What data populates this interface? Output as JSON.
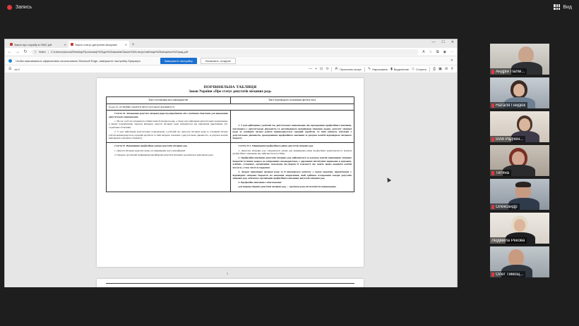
{
  "meeting": {
    "record_label": "Запись",
    "view_label": "Вид"
  },
  "browser": {
    "tabs": [
      {
        "title": "Закон про службу в ОМС.pdf",
        "active": false
      },
      {
        "title": "Закон статус депутатів місцевих",
        "active": true
      }
    ],
    "url_host": "Файл",
    "url": "C:/Users/ryboval/Desktop/Пропозиції%20до%20законів/Закон%20статус/таблиця%20місцевих%20рад.pdf",
    "notify_text": "Чтобы максимально эффективно использовать Microsoft Edge, завершите настройку браузера.",
    "notify_primary": "Завершить настройку",
    "notify_secondary": "Возможно, позднее",
    "page_indicator": "из 2",
    "toolbar": {
      "read_aloud": "Прочитать вслух",
      "draw": "Нарисовать",
      "highlight": "Выделение",
      "erase": "Стереть"
    }
  },
  "document": {
    "title": "ПОРІВНЯЛЬНА ТАБЛИЦЯ",
    "subtitle": "Закон України «Про статус депутатів місцевих рад»",
    "col_left": "Зміст положення акта законодавства",
    "col_right": "Зміст відповідного положення проекту акта",
    "section": "Розділ IV. ОСНОВНІ ГАРАНТІЇ ДЕПУТАТСЬКОЇ ДІЯЛЬНОСТІ",
    "left_1_heading": "Стаття 32. Звільнення депутата місцевої ради від виробничих або службових обов'язків для виконання депутатських повноважень",
    "left_1_p1": "1. На час сесії чи засідання постійної комісії місцевої ради, а також для здійснення депутатських повноважень в інших передбачених законом випадках депутат місцевої ради звільняється від виконання виробничих або службових обов'язків.",
    "left_1_p2": "2. У разі здійснення депутатських повноважень у робочий час депутату місцевої ради за основним місцем роботи відшкодовується середній заробіток та інші витрати, пов'язані з депутатською діяльністю, за рахунок коштів відповідного місцевого бюджету.",
    "right_1_p": "2. У разі здійснення у робочий час депутатських повноважень або проходження професійного навчання, пов'язаного з депутатською діяльністю та організованого відповідною місцевою радою, депутату місцевої ради за основним місцем роботи відшкодовується середній заробіток та інші витрати, пов'язані з депутатською діяльністю, проходженням професійного навчання за рахунок коштів відповідного місцевого бюджету.",
    "left_2_heading": "Стаття 33. Підвищення професійного рівня депутатів місцевих рад",
    "left_2_p1": "1. Депутат місцевої ради має право на підвищення свого кваліфікації.",
    "left_2_p2": "2. Порядок організації підвищення кваліфікації депутатів місцевих рад визначає відповідна рада.",
    "right_2_heading": "Стаття 33-1. Підвищення професійного рівня депутатів місцевих рад",
    "right_2_p1": "1. Депутати місцевих рад створюються умови для підвищення рівня професійної компетентності шляхом професійного навчання, яке здійснюється постійно.",
    "right_2_p2": "2. Професійне навчання депутатів місцевих рад здійснюється за рахунок коштів відповідних місцевих бюджетів та інших джерел, не заборонених законодавством, у державних інституціях переважно в наукових, освітніх, установах, організаціях, незалежно від форми їх власності, що мають право надавати освітні послуги, у тому числі за кордоном.",
    "right_2_p3": "3. Апарат відповідної місцевої ради та її виконавчого комітету у межах видатків, передбачених у відповідних місцевих бюджетах на навчання апаратників, якій здійснює планування заходів депутатів місцевих рад, забезпечує організацію професійного навчання депутатів місцевих рад.",
    "right_2_p4": "4. Професійне навчання є обов'язковим:",
    "right_2_p5": "для вперше обраних депутатів місцевих рад — протягом року після набуття повноважень;",
    "page_number": "1"
  },
  "participants": [
    {
      "name": "Андрій Палій...",
      "muted": true,
      "speaking": false
    },
    {
      "name": "Наталя Гнидюк",
      "muted": true,
      "speaking": true
    },
    {
      "name": "Ілля Радчен...",
      "muted": true,
      "speaking": false
    },
    {
      "name": "Тетяна",
      "muted": true,
      "speaking": false
    },
    {
      "name": "Олександр",
      "muted": true,
      "speaking": false
    },
    {
      "name": "Людмила Рекова",
      "muted": false,
      "speaking": false
    },
    {
      "name": "Олег Тимощ...",
      "muted": true,
      "speaking": false
    }
  ]
}
